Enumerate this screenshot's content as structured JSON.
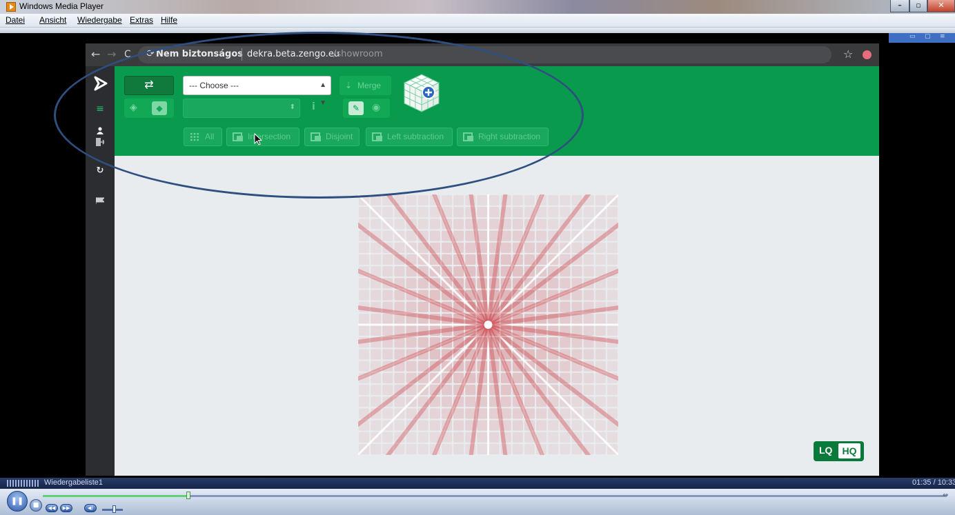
{
  "window": {
    "title": "Windows Media Player",
    "menu": [
      "Datei",
      "Ansicht",
      "Wiedergabe",
      "Extras",
      "Hilfe"
    ],
    "minimize_glyph": "–",
    "maximize_glyph": "▫",
    "close_glyph": "✕"
  },
  "browser": {
    "back": "←",
    "forward": "→",
    "reload": "C",
    "security_label": "Nem biztonságos",
    "host": "dekra.beta.zengo.eu",
    "path": "/showroom",
    "star": "☆"
  },
  "toolbar": {
    "select_placeholder": "--- Choose ---",
    "merge_label": "Merge",
    "refresh_glyph": "⇄",
    "info_glyph": "i",
    "operations": [
      "All",
      "Intersection",
      "Disjoint",
      "Left subtraction",
      "Right subtraction"
    ]
  },
  "sidebar": {
    "icons": [
      "logo-icon",
      "menu-icon",
      "user-icon",
      "logout-icon",
      "sync-icon",
      "flag-icon"
    ]
  },
  "quality": {
    "low": "LQ",
    "high": "HQ",
    "selected": "HQ"
  },
  "player": {
    "playlist_name": "Wiedergabeliste1",
    "time": "01:35 / 10:33",
    "progress": 0.161
  },
  "colors": {
    "app_green": "#0a9a4d",
    "sidebar_dark": "#2b2d30",
    "canvas_bg": "#e9ecef",
    "lattice_red": "#c8393f",
    "annotation_ellipse": "#2f4f80"
  }
}
